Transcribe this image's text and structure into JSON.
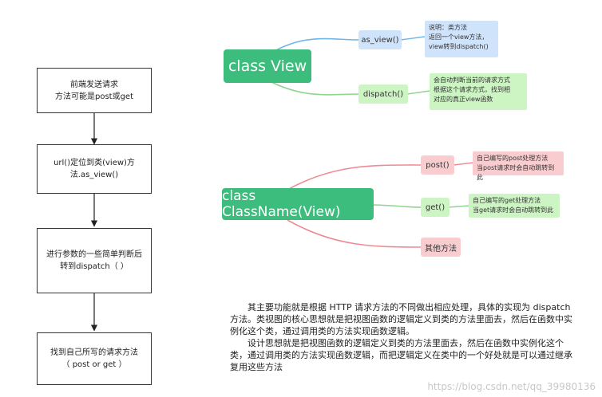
{
  "flowchart": {
    "steps": [
      "前端发送请求\n方法可能是post或get",
      "url()定位到类(view)方\n法.as_view()",
      "进行参数的一些简单判断后\n转到dispatch（ ）",
      "找到自己所写的请求方法\n（ post or get ）"
    ]
  },
  "mindmap1": {
    "root": "class View",
    "methods": [
      {
        "label": "as_view()",
        "note": "说明：类方法\n返回一个view方法，\nview转到dispatch()"
      },
      {
        "label": "dispatch()",
        "note": "会自动判断当前的请求方式\n根据这个请求方式，找到相\n对应的真正view函数"
      }
    ]
  },
  "mindmap2": {
    "root": "class ClassName(View)",
    "methods": [
      {
        "label": "post()",
        "note": "自己编写的post处理方法\n当post请求时会自动跳转到此"
      },
      {
        "label": "get()",
        "note": "自己编写的get处理方法\n当get请求时会自动跳转到此"
      },
      {
        "label": "其他方法",
        "note": ""
      }
    ]
  },
  "description": {
    "para1": "其主要功能就是根据 HTTP 请求方法的不同做出相应处理，具体的实现为 dispatch 方法。类视图的核心思想就是把视图函数的逻辑定义到类的方法里面去，然后在函数中实例化这个类，通过调用类的方法实现函数逻辑。",
    "para2": "设计思想就是把视图函数的逻辑定义到类的方法里面去，然后在函数中实例化这个类，通过调用类的方法实现函数逻辑，而把逻辑定义在类中的一个好处就是可以通过继承复用这些方法"
  },
  "watermark": "https://blog.csdn.net/qq_39980136",
  "colors": {
    "root": "#3dbd7d",
    "blue": "#cfe3fb",
    "green": "#ccf5c3",
    "red": "#f9cdd0",
    "curve_blue": "#6fb6e8",
    "curve_green": "#8fd48f",
    "curve_red": "#f08a94"
  }
}
